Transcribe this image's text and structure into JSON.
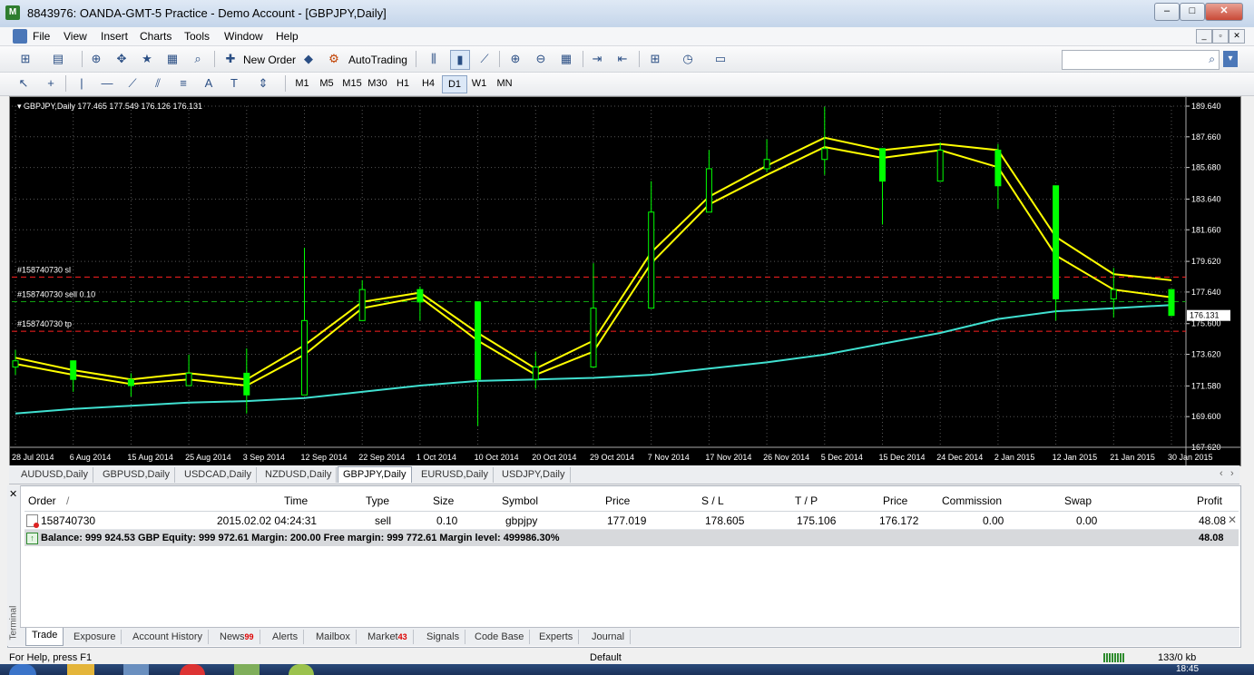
{
  "window": {
    "title": "8843976: OANDA-GMT-5 Practice - Demo Account - [GBPJPY,Daily]",
    "minimize": "–",
    "restore": "□",
    "close": "✕"
  },
  "menu": [
    "File",
    "View",
    "Insert",
    "Charts",
    "Tools",
    "Window",
    "Help"
  ],
  "toolbar": {
    "new_order_label": "New Order",
    "autotrading_label": "AutoTrading",
    "timeframes": [
      "M1",
      "M5",
      "M15",
      "M30",
      "H1",
      "H4",
      "D1",
      "W1",
      "MN"
    ],
    "active_timeframe": "D1",
    "search_placeholder": ""
  },
  "chart": {
    "header": "GBPJPY,Daily  177.465 177.549 176.126 176.131",
    "order_lines": {
      "sl_label": "#158740730 sl",
      "sell_label": "#158740730 sell 0.10",
      "tp_label": "#158740730 tp"
    },
    "current_price_label": "176.131",
    "price_axis": [
      "189.640",
      "187.660",
      "185.680",
      "183.640",
      "181.660",
      "179.620",
      "177.640",
      "175.600",
      "173.620",
      "171.580",
      "169.600",
      "167.620"
    ],
    "date_axis": [
      "28 Jul 2014",
      "6 Aug 2014",
      "15 Aug 2014",
      "25 Aug 2014",
      "3 Sep 2014",
      "12 Sep 2014",
      "22 Sep 2014",
      "1 Oct 2014",
      "10 Oct 2014",
      "20 Oct 2014",
      "29 Oct 2014",
      "7 Nov 2014",
      "17 Nov 2014",
      "26 Nov 2014",
      "5 Dec 2014",
      "15 Dec 2014",
      "24 Dec 2014",
      "2 Jan 2015",
      "12 Jan 2015",
      "21 Jan 2015",
      "30 Jan 2015"
    ],
    "colors": {
      "background": "#000000",
      "bull": "#00ff00",
      "bear": "#00ff00",
      "ma_fast": "#ffff00",
      "ma_slow": "#40e0d0",
      "sl": "#ff2020",
      "entry": "#10a010",
      "tp": "#ff2020",
      "grid": "#555555"
    }
  },
  "chart_data": {
    "type": "candlestick",
    "symbol": "GBPJPY",
    "timeframe": "Daily",
    "ylim": [
      167.62,
      189.64
    ],
    "x": [
      "28 Jul 2014",
      "6 Aug 2014",
      "15 Aug 2014",
      "25 Aug 2014",
      "3 Sep 2014",
      "12 Sep 2014",
      "22 Sep 2014",
      "1 Oct 2014",
      "10 Oct 2014",
      "20 Oct 2014",
      "29 Oct 2014",
      "7 Nov 2014",
      "17 Nov 2014",
      "26 Nov 2014",
      "5 Dec 2014",
      "15 Dec 2014",
      "24 Dec 2014",
      "2 Jan 2015",
      "12 Jan 2015",
      "21 Jan 2015",
      "30 Jan 2015"
    ],
    "close": [
      173.2,
      172.0,
      171.6,
      172.4,
      171.0,
      175.8,
      177.8,
      177.0,
      172.0,
      172.8,
      176.6,
      182.8,
      185.6,
      186.2,
      186.9,
      184.8,
      186.8,
      184.5,
      177.2,
      177.8,
      176.13
    ],
    "high": [
      173.9,
      172.8,
      172.4,
      173.6,
      174.0,
      180.5,
      178.4,
      178.0,
      174.5,
      173.8,
      179.5,
      184.8,
      186.8,
      187.5,
      189.6,
      186.6,
      187.3,
      187.2,
      180.4,
      179.2,
      177.6
    ],
    "low": [
      172.3,
      171.2,
      170.9,
      171.7,
      169.8,
      172.8,
      176.6,
      175.8,
      169.0,
      171.4,
      174.4,
      181.0,
      184.4,
      185.4,
      185.2,
      182.0,
      186.0,
      183.0,
      175.8,
      176.0,
      176.1
    ],
    "series": [
      {
        "values": [
          173.0,
          172.3,
          171.7,
          172.0,
          171.6,
          173.6,
          176.6,
          177.3,
          174.5,
          172.3,
          173.8,
          179.5,
          183.3,
          185.2,
          187.0,
          186.3,
          186.8,
          185.7,
          180.0,
          177.8,
          177.3
        ]
      },
      {
        "values": [
          173.4,
          172.6,
          172.0,
          172.4,
          172.0,
          174.2,
          177.0,
          177.6,
          175.0,
          172.7,
          174.5,
          180.2,
          183.8,
          185.8,
          187.6,
          186.8,
          187.2,
          186.8,
          181.2,
          178.8,
          178.4
        ]
      },
      {
        "values": [
          169.8,
          170.1,
          170.3,
          170.5,
          170.6,
          170.8,
          171.2,
          171.6,
          171.9,
          172.0,
          172.1,
          172.3,
          172.7,
          173.1,
          173.6,
          174.3,
          175.0,
          175.9,
          176.4,
          176.6,
          176.8
        ]
      }
    ],
    "annotations": {
      "stop_loss": 178.605,
      "entry": 177.019,
      "take_profit": 175.106
    }
  },
  "chart_tabs": [
    "AUDUSD,Daily",
    "GBPUSD,Daily",
    "USDCAD,Daily",
    "NZDUSD,Daily",
    "GBPJPY,Daily",
    "EURUSD,Daily",
    "USDJPY,Daily"
  ],
  "active_chart_tab": "GBPJPY,Daily",
  "terminal": {
    "side_label": "Terminal",
    "columns": [
      "Order",
      "/",
      "Time",
      "Type",
      "Size",
      "Symbol",
      "Price",
      "S / L",
      "T / P",
      "Price",
      "Commission",
      "Swap",
      "Profit"
    ],
    "rows": [
      {
        "order": "158740730",
        "time": "2015.02.02 04:24:31",
        "type": "sell",
        "size": "0.10",
        "symbol": "gbpjpy",
        "price": "177.019",
        "sl": "178.605",
        "tp": "175.106",
        "cur_price": "176.172",
        "commission": "0.00",
        "swap": "0.00",
        "profit": "48.08"
      }
    ],
    "balance_text": "Balance: 999 924.53 GBP  Equity: 999 972.61  Margin: 200.00  Free margin: 999 772.61  Margin level: 499986.30%",
    "balance_profit": "48.08",
    "tabs": [
      {
        "label": "Trade",
        "badge": ""
      },
      {
        "label": "Exposure",
        "badge": ""
      },
      {
        "label": "Account History",
        "badge": ""
      },
      {
        "label": "News",
        "badge": "99"
      },
      {
        "label": "Alerts",
        "badge": ""
      },
      {
        "label": "Mailbox",
        "badge": ""
      },
      {
        "label": "Market",
        "badge": "43"
      },
      {
        "label": "Signals",
        "badge": ""
      },
      {
        "label": "Code Base",
        "badge": ""
      },
      {
        "label": "Experts",
        "badge": ""
      },
      {
        "label": "Journal",
        "badge": ""
      }
    ]
  },
  "status": {
    "help": "For Help, press F1",
    "profile": "Default",
    "traffic": "133/0 kb",
    "clock": "18:45"
  }
}
